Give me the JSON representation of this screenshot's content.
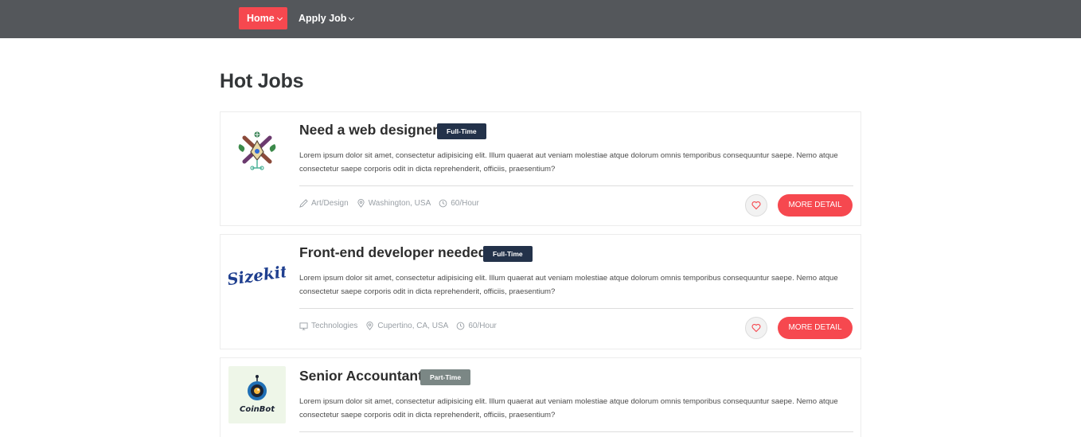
{
  "nav": {
    "home_label": "Home",
    "apply_label": "Apply Job"
  },
  "page": {
    "title": "Hot Jobs"
  },
  "jobs": [
    {
      "title": "Need a web designer",
      "type": "Full-Time",
      "description": "Lorem ipsum dolor sit amet, consectetur adipisicing elit. Illum quaerat aut veniam molestiae atque dolorum omnis temporibus consequuntur saepe. Nemo atque consectetur saepe corporis odit in dicta reprehenderit, officiis, praesentium?",
      "category": "Art/Design",
      "category_icon": "pen-icon",
      "location": "Washington, USA",
      "rate": "60/Hour",
      "detail_label": "MORE DETAIL"
    },
    {
      "title": "Front-end developer needed",
      "type": "Full-Time",
      "description": "Lorem ipsum dolor sit amet, consectetur adipisicing elit. Illum quaerat aut veniam molestiae atque dolorum omnis temporibus consequuntur saepe. Nemo atque consectetur saepe corporis odit in dicta reprehenderit, officiis, praesentium?",
      "category": "Technologies",
      "category_icon": "monitor-icon",
      "location": "Cupertino, CA, USA",
      "rate": "60/Hour",
      "detail_label": "MORE DETAIL",
      "logo_text": "Sizekit"
    },
    {
      "title": "Senior Accountant",
      "type": "Part-Time",
      "description": "Lorem ipsum dolor sit amet, consectetur adipisicing elit. Illum quaerat aut veniam molestiae atque dolorum omnis temporibus consequuntur saepe. Nemo atque consectetur saepe corporis odit in dicta reprehenderit, officiis, praesentium?",
      "logo_text": "CoinBot"
    }
  ],
  "colors": {
    "accent": "#f6484f",
    "navbar": "#54575b",
    "badge_full": "#23324a",
    "badge_part": "#7b8785"
  }
}
